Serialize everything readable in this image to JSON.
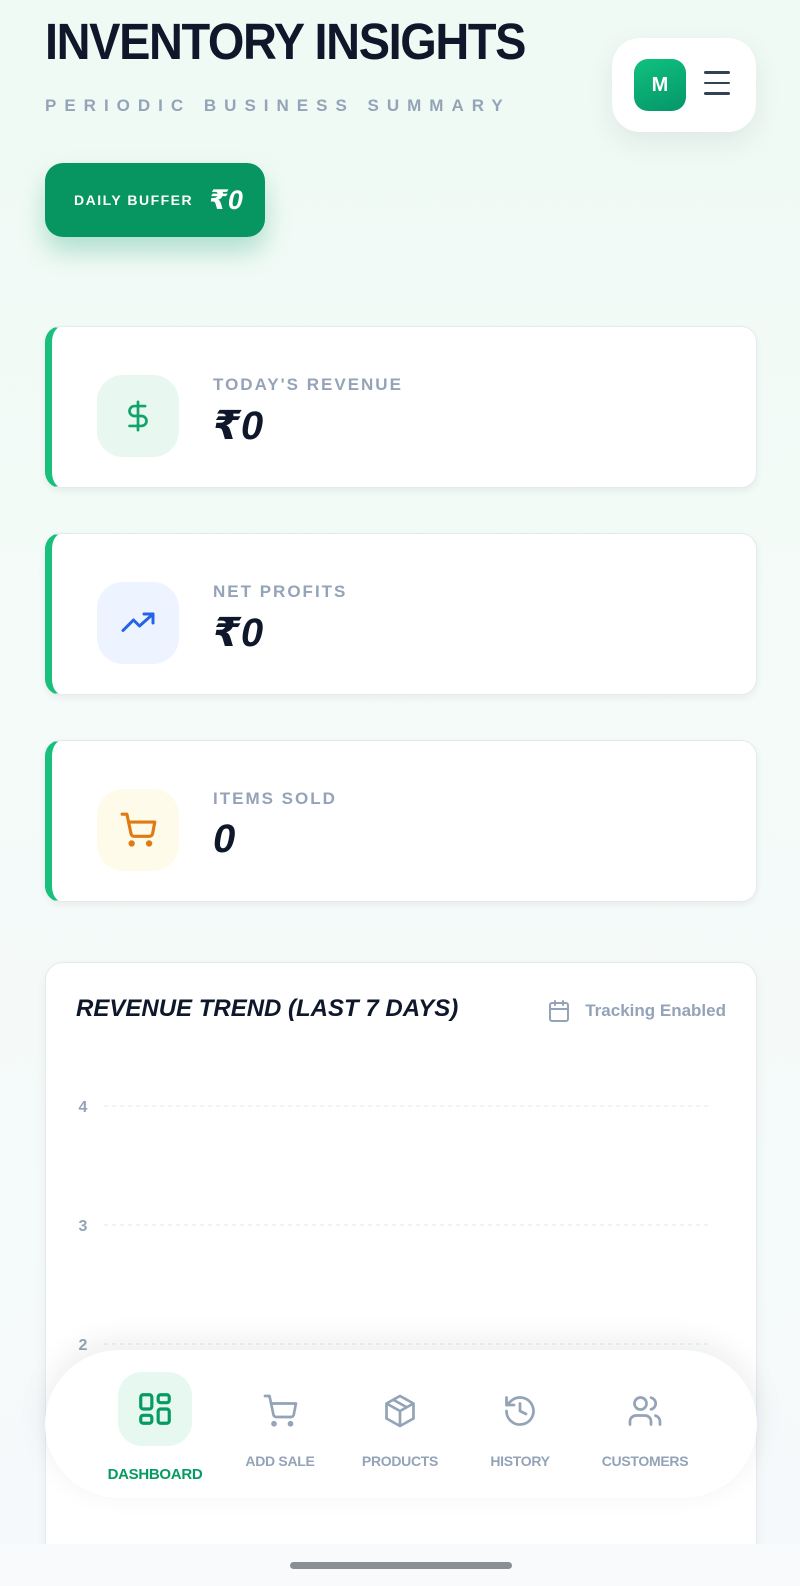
{
  "header": {
    "title": "INVENTORY INSIGHTS",
    "subtitle": "PERIODIC BUSINESS SUMMARY",
    "avatar_initial": "M",
    "menu_icon": "hamburger-menu-icon"
  },
  "buffer": {
    "label": "DAILY BUFFER",
    "value": "₹0"
  },
  "stats": [
    {
      "label": "TODAY'S REVENUE",
      "value": "₹0",
      "icon": "dollar-icon",
      "icon_color": "#10a36a",
      "icon_bg": "#e8f8f0"
    },
    {
      "label": "NET PROFITS",
      "value": "₹0",
      "icon": "trending-up-icon",
      "icon_color": "#2563eb",
      "icon_bg": "#eef4ff"
    },
    {
      "label": "ITEMS SOLD",
      "value": "0",
      "icon": "cart-icon",
      "icon_color": "#e07b12",
      "icon_bg": "#fffbea"
    }
  ],
  "chart_card": {
    "title": "REVENUE TREND (LAST 7 DAYS)",
    "tracking_label": "Tracking Enabled",
    "tracking_icon": "calendar-icon"
  },
  "chart_data": {
    "type": "line",
    "title": "REVENUE TREND (LAST 7 DAYS)",
    "y_ticks_visible": [
      4,
      3,
      2
    ],
    "ylim": [
      0,
      4
    ],
    "grid": true,
    "series": []
  },
  "nav": {
    "items": [
      {
        "label": "DASHBOARD",
        "icon": "dashboard-grid-icon",
        "active": true
      },
      {
        "label": "ADD SALE",
        "icon": "cart-icon",
        "active": false
      },
      {
        "label": "PRODUCTS",
        "icon": "box-icon",
        "active": false
      },
      {
        "label": "HISTORY",
        "icon": "history-icon",
        "active": false
      },
      {
        "label": "CUSTOMERS",
        "icon": "users-icon",
        "active": false
      }
    ]
  },
  "colors": {
    "accent": "#079561",
    "card_border_accent": "#19bf7c",
    "muted_text": "#94a3b8",
    "heading_text": "#0f172a"
  }
}
